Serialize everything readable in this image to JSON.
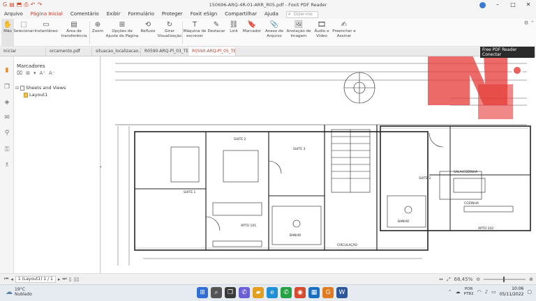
{
  "window": {
    "title": "150696-ARQ-4R-01-ARR_R05.pdf - Foxit PDF Reader",
    "controls": [
      "–",
      "□",
      "✕"
    ]
  },
  "menu": {
    "items": [
      "Arquivo",
      "Página Inicial",
      "Comentário",
      "Exibir",
      "Formulário",
      "Proteger",
      "Foxit eSign",
      "Compartilhar",
      "Ajuda"
    ],
    "active_index": 1,
    "search_placeholder": "Dizer-me"
  },
  "ribbon": {
    "buttons": [
      {
        "icon": "✋",
        "label": "Mão",
        "name": "hand-tool"
      },
      {
        "icon": "⬚",
        "label": "Selecionar",
        "name": "select-tool"
      },
      {
        "icon": "▭",
        "label": "Instantâneo",
        "name": "snapshot-tool"
      },
      {
        "icon": "▤",
        "label": "Área de transferência",
        "name": "clipboard"
      },
      {
        "icon": "⊕",
        "label": "Zoom",
        "name": "zoom"
      },
      {
        "icon": "⊞",
        "label": "Opções de Ajuste de Página",
        "name": "page-fit"
      },
      {
        "icon": "⟲",
        "label": "Refluxo",
        "name": "reflow"
      },
      {
        "icon": "↻",
        "label": "Girar Visualização",
        "name": "rotate-view"
      },
      {
        "icon": "T",
        "label": "Máquina de escrever",
        "name": "typewriter"
      },
      {
        "icon": "✎",
        "label": "Destacar",
        "name": "highlight"
      },
      {
        "icon": "⛓",
        "label": "Link",
        "name": "link"
      },
      {
        "icon": "🔖",
        "label": "Marcador",
        "name": "bookmark"
      },
      {
        "icon": "📎",
        "label": "Anexo de Arquivo",
        "name": "file-attachment"
      },
      {
        "icon": "🖼",
        "label": "Anotação de Imagem",
        "name": "image-annotation"
      },
      {
        "icon": "🎞",
        "label": "Áudio e Vídeo",
        "name": "audio-video"
      },
      {
        "icon": "✍",
        "label": "Preencher e Assinar",
        "name": "fill-sign"
      }
    ],
    "active_index": 0
  },
  "doc_tabs": [
    {
      "label": "Iniciar",
      "active": false
    },
    {
      "label": "orcamento.pdf",
      "active": false
    },
    {
      "label": "situacao_localizacao...",
      "active": false
    },
    {
      "label": "R0590-ARQ-Pl_03_TE...",
      "active": false
    },
    {
      "label": "R0590-ARQ-Pl_05_TE...",
      "active": true
    }
  ],
  "sidebar": {
    "rail_icons": [
      "bookmark-icon",
      "pages-icon",
      "layers-icon",
      "comments-icon",
      "attachment-icon",
      "security-icon",
      "signature-icon"
    ],
    "panel_title": "Marcadores",
    "tools": [
      "⌧",
      "⊞",
      "▾",
      "A⁺",
      "A⁻"
    ],
    "tree": [
      {
        "label": "Sheets and Views",
        "level": 0,
        "expanded": true
      },
      {
        "label": "Layout1",
        "level": 1,
        "expanded": false
      }
    ]
  },
  "canvas": {
    "room_labels": [
      "SUITE 1",
      "SUITE 2",
      "SUITE 3",
      "SUITE 2",
      "APTO 101",
      "APTO 102",
      "CIRCULAÇÃO",
      "BANHO",
      "BANHO",
      "SALA/COZINHA",
      "COZINHA"
    ]
  },
  "notification": {
    "line1": "Free PDF Reader",
    "line2": "Conectar"
  },
  "statusbar": {
    "page_indicator": "1 (Layout1) 1 / 1",
    "zoom_label": "68,45%"
  },
  "taskbar": {
    "weather_temp": "19°C",
    "weather_desc": "Nublado",
    "lang_line1": "POR",
    "lang_line2": "PTB2",
    "time": "10:06",
    "date": "05/11/2022"
  },
  "colors": {
    "accent": "#c0392b",
    "logo_red": "#e53935"
  }
}
